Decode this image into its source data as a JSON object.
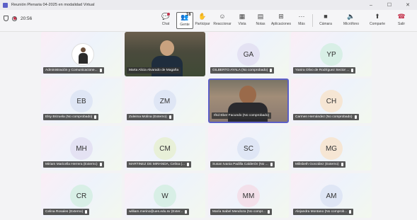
{
  "window": {
    "title": "Reunión Plenaria 04-2025 en modalidad Virtual",
    "controls": [
      "–",
      "☐",
      "✕"
    ]
  },
  "meeting": {
    "timer": "20:56"
  },
  "toolbar": {
    "chat": "Chat",
    "people": "Gente",
    "people_count": "16",
    "raise": "Participar",
    "react": "Reaccionar",
    "view": "Vista",
    "notes": "Notas",
    "apps": "Aplicaciones",
    "more": "Más",
    "camera": "Cámara",
    "mic": "Micrófono",
    "share": "Comparte",
    "leave": "Salir"
  },
  "participants": [
    {
      "name": "Administración y Comunicacione...",
      "initials": "",
      "kind": "avatar-photo"
    },
    {
      "name": "Marta Alicia Alvarado de Magaña",
      "initials": "",
      "kind": "video"
    },
    {
      "name": "GILBERTO AYALA (No comprobado)",
      "initials": "GA",
      "kind": "initials"
    },
    {
      "name": "Yanira Olivo de Rodríguez Sector ...",
      "initials": "YP",
      "kind": "initials"
    },
    {
      "name": "Elsy Brizuela (No comprobado)",
      "initials": "EB",
      "kind": "initials"
    },
    {
      "name": "Zuleima Molina (Externo)",
      "initials": "ZM",
      "kind": "initials"
    },
    {
      "name": "Ifrid Eber Facundo (No comprobado)",
      "initials": "",
      "kind": "video"
    },
    {
      "name": "Carmen Hernández (No comprobado)",
      "initials": "CH",
      "kind": "initials"
    },
    {
      "name": "Miriam Maricella Herrera (Externo)",
      "initials": "MH",
      "kind": "initials"
    },
    {
      "name": "MARTINEZ DE MIRANDA, Celina (...",
      "initials": "CM",
      "kind": "initials"
    },
    {
      "name": "Susan Ivania Padilla Calderón (No ...",
      "initials": "SC",
      "kind": "initials"
    },
    {
      "name": "Milisbeth González (Externo)",
      "initials": "MG",
      "kind": "initials"
    },
    {
      "name": "Celina Rosales (Externo)",
      "initials": "CR",
      "kind": "initials"
    },
    {
      "name": "william.merino@ues.edu.sv (Exter...",
      "initials": "W",
      "kind": "initials"
    },
    {
      "name": "María Isabel Mendoza (No compr...",
      "initials": "MM",
      "kind": "initials"
    },
    {
      "name": "Alejandra Montano (No comprob...",
      "initials": "AM",
      "kind": "initials"
    }
  ]
}
